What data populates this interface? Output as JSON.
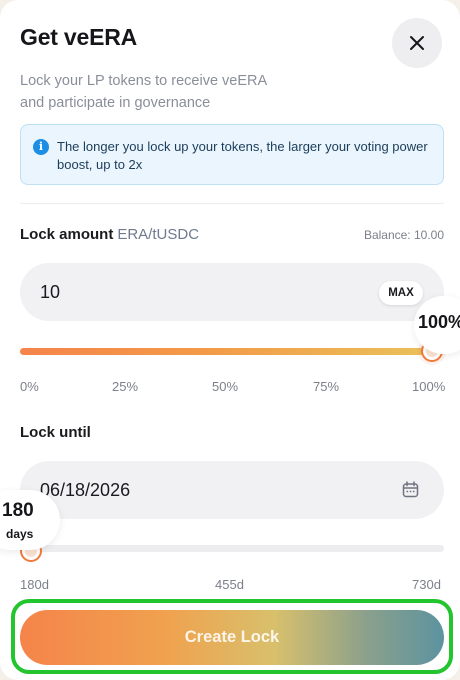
{
  "modal": {
    "title": "Get veERA",
    "subtitle_line1": "Lock your LP tokens to receive veERA",
    "subtitle_line2": "and participate in governance"
  },
  "info": {
    "icon": "info-icon",
    "text": "The longer you lock up your tokens, the larger your voting power boost, up to 2x",
    "accent": "#1c8ee6"
  },
  "lock_amount": {
    "label": "Lock amount",
    "pair": "ERA/tUSDC",
    "balance": "Balance: 10.00",
    "value": "10",
    "max_label": "MAX",
    "percent_label": "100%",
    "slider_fraction": 1.0,
    "ticks": [
      "0%",
      "25%",
      "50%",
      "75%",
      "100%"
    ]
  },
  "lock_until": {
    "label": "Lock until",
    "date_value": "06/18/2026",
    "calendar_icon": "calendar-icon",
    "days_value": "180",
    "days_unit": "days",
    "slider_fraction": 0.0,
    "ticks": [
      "180d",
      "455d",
      "730d"
    ]
  },
  "actions": {
    "create_label": "Create Lock",
    "highlight_color": "#22c52e"
  },
  "colors": {
    "slider_start": "#f5844a",
    "slider_end": "#e8c35a",
    "button_start": "#f5844a",
    "button_end": "#5c93a0"
  }
}
